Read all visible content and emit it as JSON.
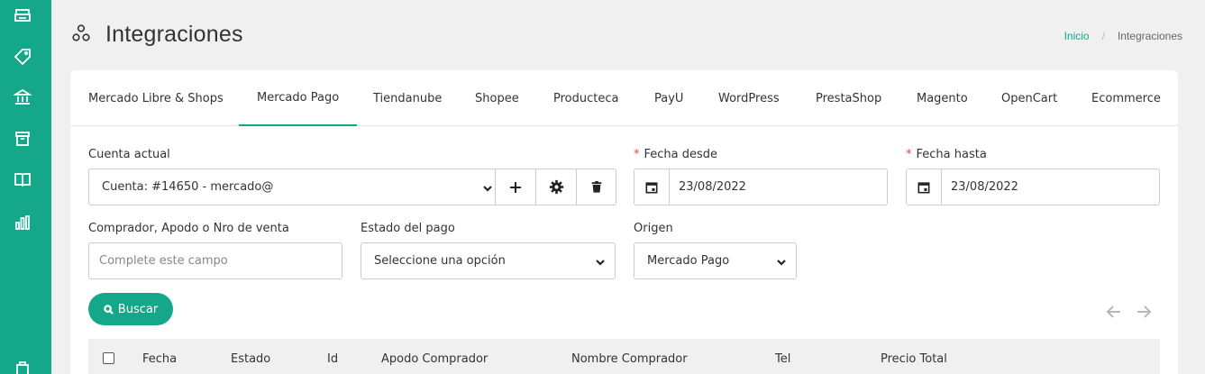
{
  "sidebar": {
    "icons": [
      "printer-icon",
      "tag-icon",
      "bank-icon",
      "box-icon",
      "book-icon",
      "bar-chart-icon",
      "bag-icon"
    ]
  },
  "header": {
    "title": "Integraciones",
    "breadcrumb": {
      "home": "Inicio",
      "separator": "/",
      "current": "Integraciones"
    }
  },
  "tabs": [
    {
      "label": "Mercado Libre & Shops"
    },
    {
      "label": "Mercado Pago"
    },
    {
      "label": "Tiendanube"
    },
    {
      "label": "Shopee"
    },
    {
      "label": "Producteca"
    },
    {
      "label": "PayU"
    },
    {
      "label": "WordPress"
    },
    {
      "label": "PrestaShop"
    },
    {
      "label": "Magento"
    },
    {
      "label": "OpenCart"
    },
    {
      "label": "Ecommerce"
    }
  ],
  "active_tab": "Mercado Pago",
  "filters": {
    "account": {
      "label": "Cuenta actual",
      "value": "Cuenta: #14650 - mercado@"
    },
    "date_from": {
      "required_mark": "*",
      "label": "Fecha desde",
      "value": "23/08/2022"
    },
    "date_to": {
      "required_mark": "*",
      "label": "Fecha hasta",
      "value": "23/08/2022"
    },
    "buyer": {
      "label": "Comprador, Apodo o Nro de venta",
      "placeholder": "Complete este campo"
    },
    "payment_status": {
      "label": "Estado del pago",
      "value": "Seleccione una opción"
    },
    "origin": {
      "label": "Origen",
      "value": "Mercado Pago"
    }
  },
  "search_button": "Buscar",
  "table": {
    "columns": [
      "Fecha",
      "Estado",
      "Id",
      "Apodo Comprador",
      "Nombre Comprador",
      "Tel",
      "Precio Total"
    ]
  },
  "colors": {
    "accent": "#15a78a",
    "required": "#e44444"
  }
}
